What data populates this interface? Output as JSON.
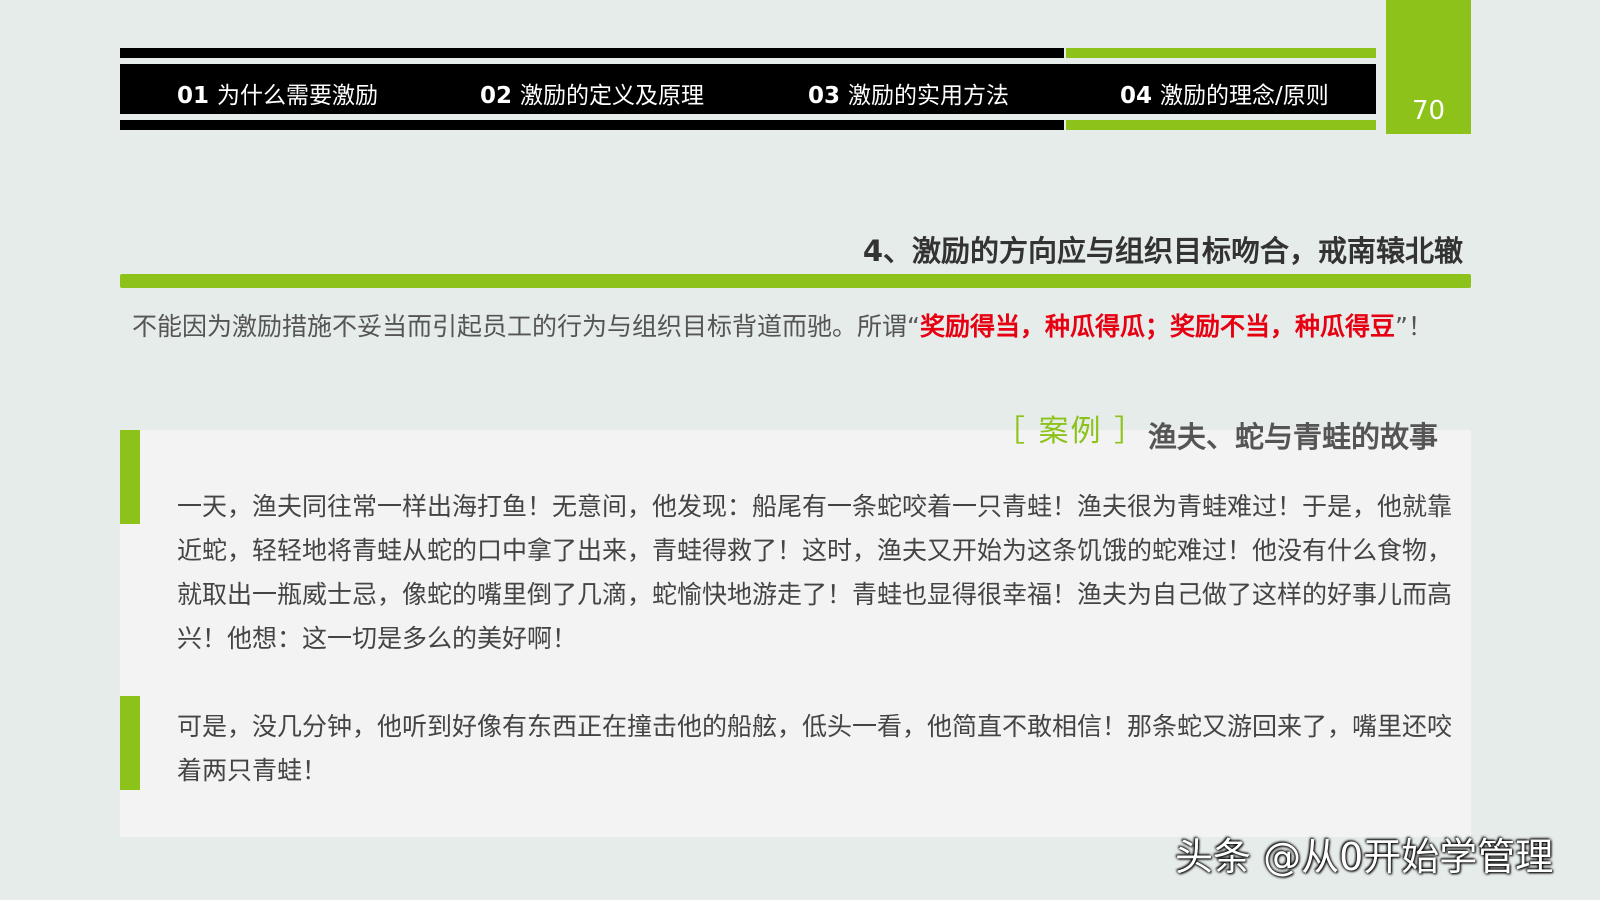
{
  "nav": {
    "items": [
      {
        "num": "01",
        "label": "为什么需要激励"
      },
      {
        "num": "02",
        "label": "激励的定义及原理"
      },
      {
        "num": "03",
        "label": "激励的实用方法"
      },
      {
        "num": "04",
        "label": "激励的理念/原则"
      }
    ],
    "page_number": "70"
  },
  "section": {
    "title": "4、激励的方向应与组织目标吻合，戒南辕北辙"
  },
  "intro": {
    "text": "不能因为激励措施不妥当而引起员工的行为与组织目标背道而驰。所谓“",
    "highlight": "奖励得当，种瓜得瓜；奖励不当，种瓜得豆",
    "suffix": "”！"
  },
  "case": {
    "label": "［ 案例 ］",
    "title": "渔夫、蛇与青蛙的故事",
    "paragraphs": [
      "一天，渔夫同往常一样出海打鱼！无意间，他发现：船尾有一条蛇咬着一只青蛙！渔夫很为青蛙难过！于是，他就靠近蛇，轻轻地将青蛙从蛇的口中拿了出来，青蛙得救了！这时，渔夫又开始为这条饥饿的蛇难过！他没有什么食物，就取出一瓶威士忌，像蛇的嘴里倒了几滴，蛇愉快地游走了！青蛙也显得很幸福！渔夫为自己做了这样的好事儿而高兴！他想：这一切是多么的美好啊！",
      "可是，没几分钟，他听到好像有东西正在撞击他的船舷，低头一看，他简直不敢相信！那条蛇又游回来了，嘴里还咬着两只青蛙！"
    ]
  },
  "watermark": "头条 @从0开始学管理",
  "colors": {
    "accent": "#8cc21a",
    "highlight": "#e60012",
    "background": "#e6ecea"
  }
}
